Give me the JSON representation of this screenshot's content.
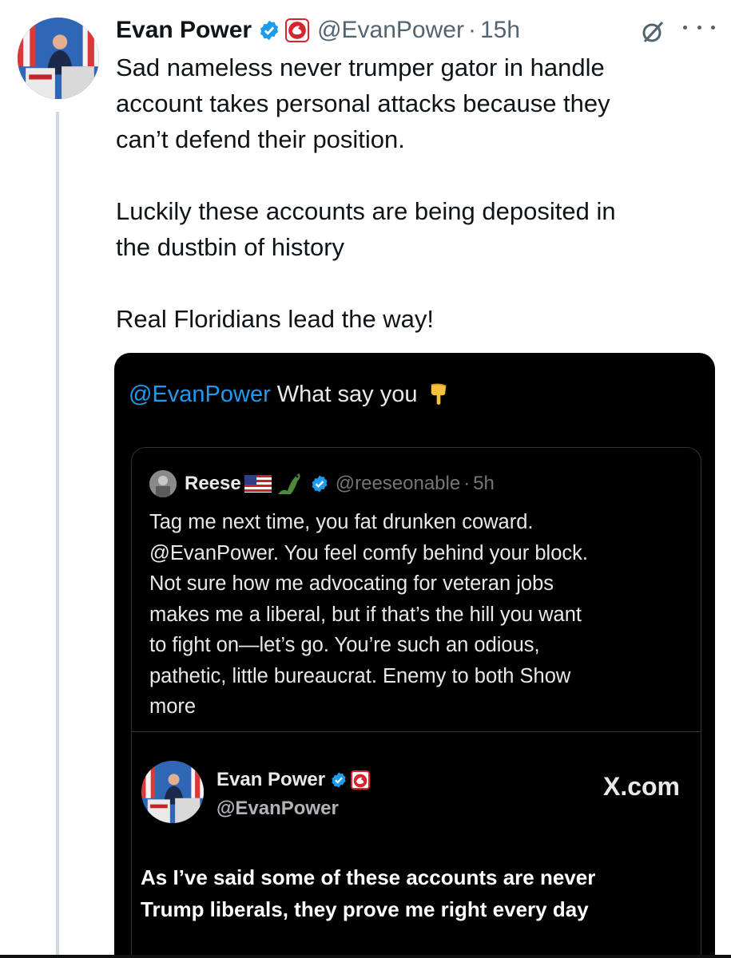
{
  "tweet": {
    "author_name": "Evan Power",
    "handle": "@EvanPower",
    "separator": "·",
    "time": "15h",
    "paragraphs": [
      "Sad nameless never trumper gator in handle\naccount takes personal attacks because they\ncan’t defend their position.",
      "Luckily these accounts are being deposited in\nthe dustbin of history",
      "Real Floridians lead the way!"
    ],
    "icons": {
      "verified": "verified-badge-icon",
      "affiliation": "affiliation-badge-icon",
      "grok": "grok-icon",
      "more": "more-icon"
    }
  },
  "media": {
    "mention": "@EvanPower",
    "text": " What say you",
    "emoji": "pointing-down-icon",
    "quote": {
      "name": "Reese",
      "handle": "@reeseonable",
      "separator": "·",
      "time": "5h",
      "body": "Tag me next time, you fat drunken coward.\n@EvanPower. You feel comfy behind your block.\nNot sure how me advocating for veteran jobs\nmakes me a liberal, but if that’s the hill you want\nto fight on—let’s go. You’re such an odious,\npathetic, little bureaucrat. Enemy to both ",
      "show_more": "Show\nmore"
    },
    "inner_card": {
      "name": "Evan Power",
      "handle": "@EvanPower",
      "site": "X.com",
      "body": "As I’ve said some of these accounts are never\nTrump liberals, they prove me right every day"
    }
  },
  "colors": {
    "accent": "#1d9bf0",
    "text": "#0f1419",
    "muted": "#536471",
    "dark_bg": "#000000",
    "dark_text": "#e7e9ea"
  }
}
